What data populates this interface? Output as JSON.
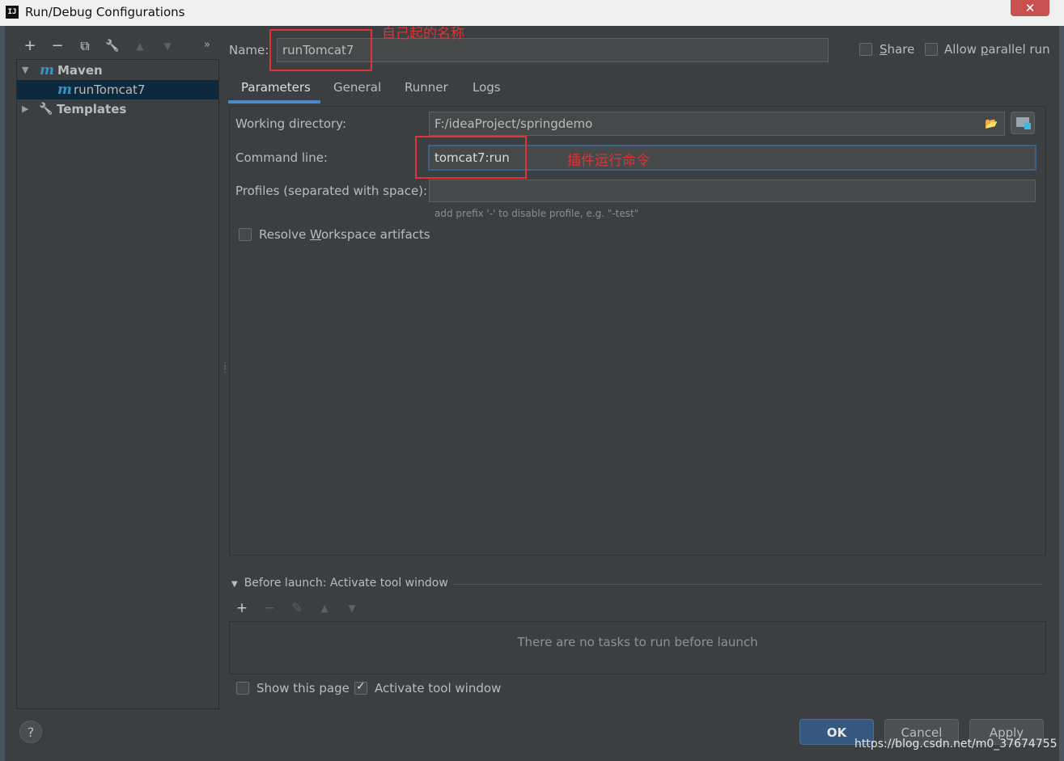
{
  "window": {
    "title": "Run/Debug Configurations",
    "close_glyph": "✕"
  },
  "toolbar": {
    "add": "+",
    "remove": "−",
    "copy": "⧉",
    "edit": "🔧",
    "up": "▲",
    "down": "▼",
    "more": "»"
  },
  "tree": {
    "maven_icon": "m",
    "maven_label": "Maven",
    "config_icon": "m",
    "config_label": "runTomcat7",
    "templates_label": "Templates"
  },
  "name": {
    "label": "Name:",
    "value": "runTomcat7"
  },
  "share": {
    "label_pre": "",
    "mnemonic": "S",
    "label_post": "hare",
    "checked": false
  },
  "parallel": {
    "label_pre": "Allow ",
    "mnemonic": "p",
    "label_post": "arallel run",
    "checked": false
  },
  "tabs": [
    "Parameters",
    "General",
    "Runner",
    "Logs"
  ],
  "params": {
    "working_dir_label": "Working directory:",
    "working_dir_value": "F:/ideaProject/springdemo",
    "command_line_label": "Command line:",
    "command_line_value": "tomcat7:run",
    "profiles_label": "Profiles (separated with space):",
    "profiles_value": "",
    "profiles_hint": "add prefix '-' to disable profile, e.g. \"-test\"",
    "resolve_pre": "Resolve ",
    "resolve_mnemonic": "W",
    "resolve_post": "orkspace artifacts"
  },
  "annotations": {
    "name_note": "自己起的名称",
    "cmd_note": "插件运行命令"
  },
  "before_launch": {
    "header": "Before launch: Activate tool window",
    "empty_text": "There are no tasks to run before launch",
    "tb_add": "+",
    "tb_remove": "−",
    "tb_edit": "✎",
    "tb_up": "▲",
    "tb_down": "▼"
  },
  "show_page": {
    "label": "Show this page",
    "checked": false
  },
  "activate_tool": {
    "label": "Activate tool window",
    "checked": true
  },
  "buttons": {
    "help": "?",
    "ok": "OK",
    "cancel": "Cancel",
    "apply": "Apply"
  },
  "watermark": "https://blog.csdn.net/m0_37674755",
  "colors": {
    "background": "#3c3f41",
    "selection": "#0d293e",
    "accent": "#4a88c7",
    "annotation": "#e23232"
  }
}
